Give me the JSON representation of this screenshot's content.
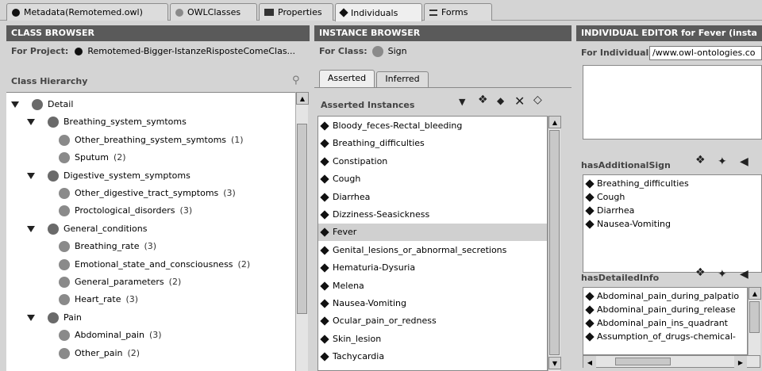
{
  "tabs": [
    {
      "label": "Metadata(Remotemed.owl)",
      "icon": "diamond-dot-icon"
    },
    {
      "label": "OWLClasses",
      "icon": "grey-circle-icon"
    },
    {
      "label": "Properties",
      "icon": "rectangle-icon"
    },
    {
      "label": "Individuals",
      "icon": "diamond-icon"
    },
    {
      "label": "Forms",
      "icon": "forms-icon"
    }
  ],
  "class_browser": {
    "title": "CLASS BROWSER",
    "project_label": "For Project:",
    "project_value": "Remotemed-Bigger-IstanzeRisposteComeClas...",
    "hierarchy_label": "Class Hierarchy",
    "tree": [
      {
        "label": "Detail",
        "count": "",
        "level": 0,
        "expanded": true
      },
      {
        "label": "Breathing_system_symtoms",
        "count": "",
        "level": 1,
        "expanded": true
      },
      {
        "label": "Other_breathing_system_symtoms",
        "count": "(1)",
        "level": 2
      },
      {
        "label": "Sputum",
        "count": "(2)",
        "level": 2
      },
      {
        "label": "Digestive_system_symptoms",
        "count": "",
        "level": 1,
        "expanded": true
      },
      {
        "label": "Other_digestive_tract_symptoms",
        "count": "(3)",
        "level": 2
      },
      {
        "label": "Proctological_disorders",
        "count": "(3)",
        "level": 2
      },
      {
        "label": "General_conditions",
        "count": "",
        "level": 1,
        "expanded": true
      },
      {
        "label": "Breathing_rate",
        "count": "(3)",
        "level": 2
      },
      {
        "label": "Emotional_state_and_consciousness",
        "count": "(2)",
        "level": 2
      },
      {
        "label": "General_parameters",
        "count": "(2)",
        "level": 2
      },
      {
        "label": "Heart_rate",
        "count": "(3)",
        "level": 2
      },
      {
        "label": "Pain",
        "count": "",
        "level": 1,
        "expanded": true
      },
      {
        "label": "Abdominal_pain",
        "count": "(3)",
        "level": 2
      },
      {
        "label": "Other_pain",
        "count": "(2)",
        "level": 2
      }
    ]
  },
  "instance_browser": {
    "title": "INSTANCE BROWSER",
    "class_label": "For Class:",
    "class_value": "Sign",
    "tab_asserted": "Asserted",
    "tab_inferred": "Inferred",
    "list_label": "Asserted Instances",
    "instances": [
      "Bloody_feces-Rectal_bleeding",
      "Breathing_difficulties",
      "Constipation",
      "Cough",
      "Diarrhea",
      "Dizziness-Seasickness",
      "Fever",
      "Genital_lesions_or_abnormal_secretions",
      "Hematuria-Dysuria",
      "Melena",
      "Nausea-Vomiting",
      "Ocular_pain_or_redness",
      "Skin_lesion",
      "Tachycardia"
    ],
    "selected": "Fever"
  },
  "individual_editor": {
    "title": "INDIVIDUAL EDITOR for Fever   (insta",
    "individual_label": "For Individual:",
    "individual_value": "/www.owl-ontologies.co",
    "sign_label": "hasAdditionalSign",
    "signs": [
      "Breathing_difficulties",
      "Cough",
      "Diarrhea",
      "Nausea-Vomiting"
    ],
    "info_label": "hasDetailedInfo",
    "infos": [
      "Abdominal_pain_during_palpatio",
      "Abdominal_pain_during_release",
      "Abdominal_pain_ins_quadrant",
      "Assumption_of_drugs-chemical-"
    ]
  }
}
